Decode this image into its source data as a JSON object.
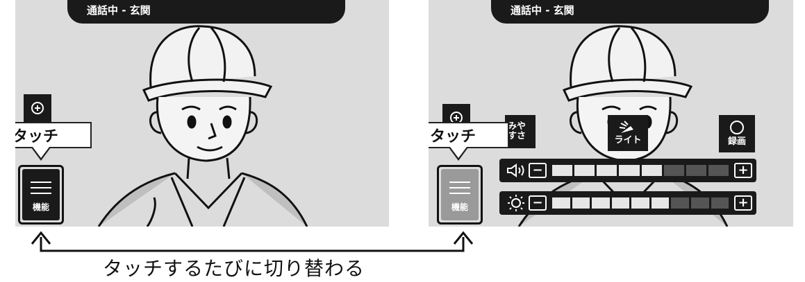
{
  "left_screen": {
    "status": "通話中 - 玄関",
    "touch_label": "タッチ",
    "func_label": "機能",
    "zoom_icon": "zoom-in-icon"
  },
  "right_screen": {
    "status": "通話中 - 玄関",
    "touch_label": "タッチ",
    "func_label": "機能",
    "zoom_icon": "zoom-in-icon",
    "easy_listen_line1": "みや",
    "easy_listen_line2": "すさ",
    "light_label": "ライト",
    "record_label": "録画",
    "volume": {
      "icon": "speaker-icon",
      "filled": 5,
      "total": 8,
      "minus": "−",
      "plus": "+"
    },
    "brightness": {
      "icon": "sun-icon",
      "filled": 6,
      "total": 9,
      "minus": "−",
      "plus": "+"
    }
  },
  "caption": "タッチするたびに切り替わる",
  "colors": {
    "screen_bg": "#dcdcdc",
    "panel": "#1a1a1a",
    "seg_on": "#e6e6e6",
    "seg_off": "#555555"
  }
}
